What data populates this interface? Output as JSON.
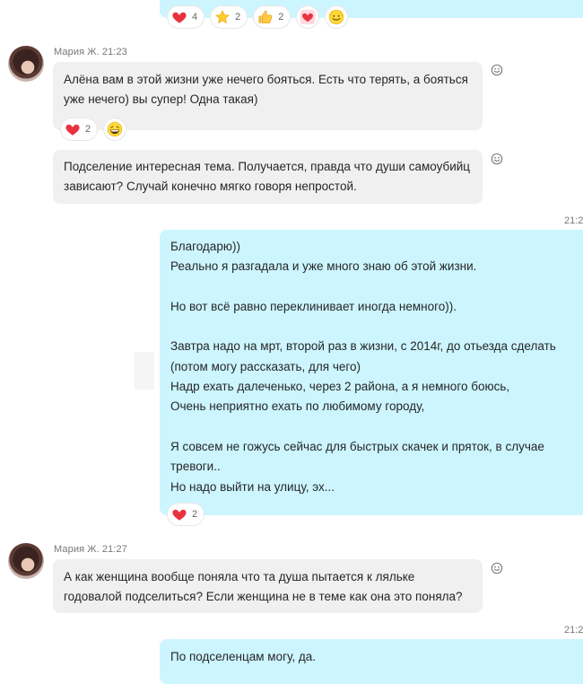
{
  "top_reactions": [
    {
      "icon": "heart-icon",
      "count": "4"
    },
    {
      "icon": "star-icon",
      "count": "2"
    },
    {
      "icon": "thumbs-up-icon",
      "count": "2"
    },
    {
      "icon": "heart-badge-icon",
      "count": ""
    },
    {
      "icon": "smile-icon",
      "count": ""
    }
  ],
  "group1": {
    "sender": "Мария Ж.",
    "time": "21:23",
    "msg1": [
      "Алёна вам в этой жизни уже нечего бояться. Есть что терять, а бояться",
      "уже нечего) вы супер! Одна такая)"
    ],
    "msg1_reactions": [
      {
        "icon": "heart-icon",
        "count": "2"
      },
      {
        "icon": "laugh-icon",
        "count": ""
      }
    ],
    "msg2": [
      "Подселение интересная тема. Получается, правда что души самоубийц",
      "зависают? Случай конечно мягко говоря непростой."
    ]
  },
  "own1": {
    "time": "21:2",
    "lines": [
      "Благодарю))",
      "Реально я разгадала и уже много знаю об этой жизни.",
      "",
      "Но вот всё равно переклинивает иногда немного)).",
      "",
      "Завтра надо на мрт, второй раз в жизни, с 2014г, до отьезда сделать",
      "(потом могу рассказать, для чего)",
      "Надр ехать далеченько, через 2 района, а я немного боюсь,",
      "Очень неприятно ехать по любимому городу,",
      "",
      "Я совсем не гожусь сейчас для быстрых скачек и пряток, в случае",
      "тревоги..",
      "Но надо выйти на улицу, эх..."
    ],
    "reactions": [
      {
        "icon": "heart-icon",
        "count": "2"
      }
    ]
  },
  "group2": {
    "sender": "Мария Ж.",
    "time": "21:27",
    "msg1": [
      "А как женщина вообще поняла что та душа пытается к ляльке",
      "годовалой подселиться? Если женщина не в теме как она это поняла?"
    ]
  },
  "own2": {
    "time": "21:2",
    "lines": [
      "По подселенцам могу,  да."
    ]
  },
  "colors": {
    "outgoing": "#ccf5ff",
    "incoming": "#f0f0f0",
    "heart": "#e8333f"
  }
}
